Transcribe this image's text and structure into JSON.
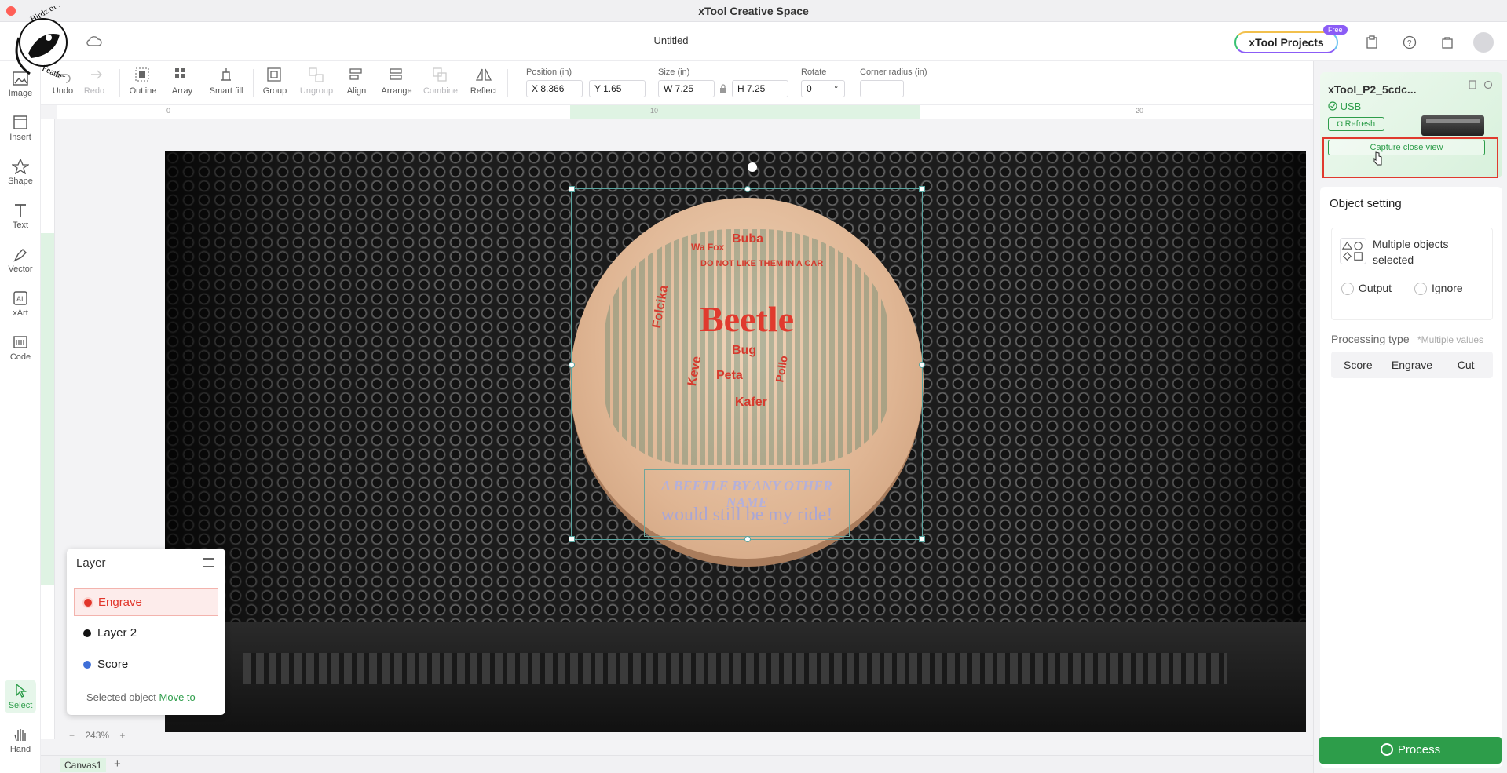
{
  "window": {
    "title": "xTool Creative Space",
    "doc_title": "Untitled"
  },
  "logo_text": "Birdz of a Feather",
  "header": {
    "projects": "xTool Projects",
    "free_badge": "Free"
  },
  "left_tools": [
    {
      "label": "Image",
      "icon": "image-icon"
    },
    {
      "label": "Insert",
      "icon": "insert-icon"
    },
    {
      "label": "Shape",
      "icon": "shape-icon"
    },
    {
      "label": "Text",
      "icon": "text-icon"
    },
    {
      "label": "Vector",
      "icon": "vector-icon"
    },
    {
      "label": "xArt",
      "icon": "xart-icon"
    },
    {
      "label": "Code",
      "icon": "code-icon"
    },
    {
      "label": "Select",
      "icon": "select-icon"
    },
    {
      "label": "Hand",
      "icon": "hand-icon"
    }
  ],
  "toolbar": {
    "undo": "Undo",
    "redo": "Redo",
    "outline": "Outline",
    "array": "Array",
    "smart_fill": "Smart fill",
    "group": "Group",
    "ungroup": "Ungroup",
    "align": "Align",
    "arrange": "Arrange",
    "combine": "Combine",
    "reflect": "Reflect",
    "position_label": "Position (in)",
    "x": "X 8.366",
    "y": "Y 1.65",
    "size_label": "Size (in)",
    "w": "W 7.25",
    "h": "H 7.25",
    "rotate_label": "Rotate",
    "rotate": "0",
    "rotate_unit": "°",
    "corner_label": "Corner radius (in)",
    "corner": ""
  },
  "ruler": {
    "t0": "0",
    "t10": "10",
    "t20": "20"
  },
  "artwork": {
    "main": "Beetle",
    "words": [
      "Buba",
      "Wa Fox",
      "DO NOT LIKE THEM IN A CAR",
      "Folcika",
      "Keve",
      "Bug",
      "Peta",
      "Kafer",
      "Pollo"
    ],
    "line1": "A BEETLE BY ANY OTHER NAME",
    "line2": "would still be my ride!"
  },
  "layer_panel": {
    "title": "Layer",
    "items": [
      {
        "name": "Engrave",
        "color": "#e1352a"
      },
      {
        "name": "Layer 2",
        "color": "#111111"
      },
      {
        "name": "Score",
        "color": "#3f6fd8"
      }
    ],
    "footer_text": "Selected object",
    "footer_link": "Move to"
  },
  "zoom": "243%",
  "zoom_minus": "−",
  "zoom_plus": "+",
  "tab": {
    "name": "Canvas1",
    "add": "+"
  },
  "device": {
    "name": "xTool_P2_5cdc...",
    "connection": "USB",
    "refresh": "Refresh",
    "capture": "Capture close view"
  },
  "object_setting": {
    "title": "Object setting",
    "multiple": "Multiple objects selected",
    "output": "Output",
    "ignore": "Ignore",
    "processing_label": "Processing type",
    "processing_note": "*Multiple values",
    "types": [
      "Score",
      "Engrave",
      "Cut"
    ]
  },
  "process": "Process",
  "colors": {
    "accent": "#2d9d4a",
    "highlight": "#e03a2e"
  }
}
